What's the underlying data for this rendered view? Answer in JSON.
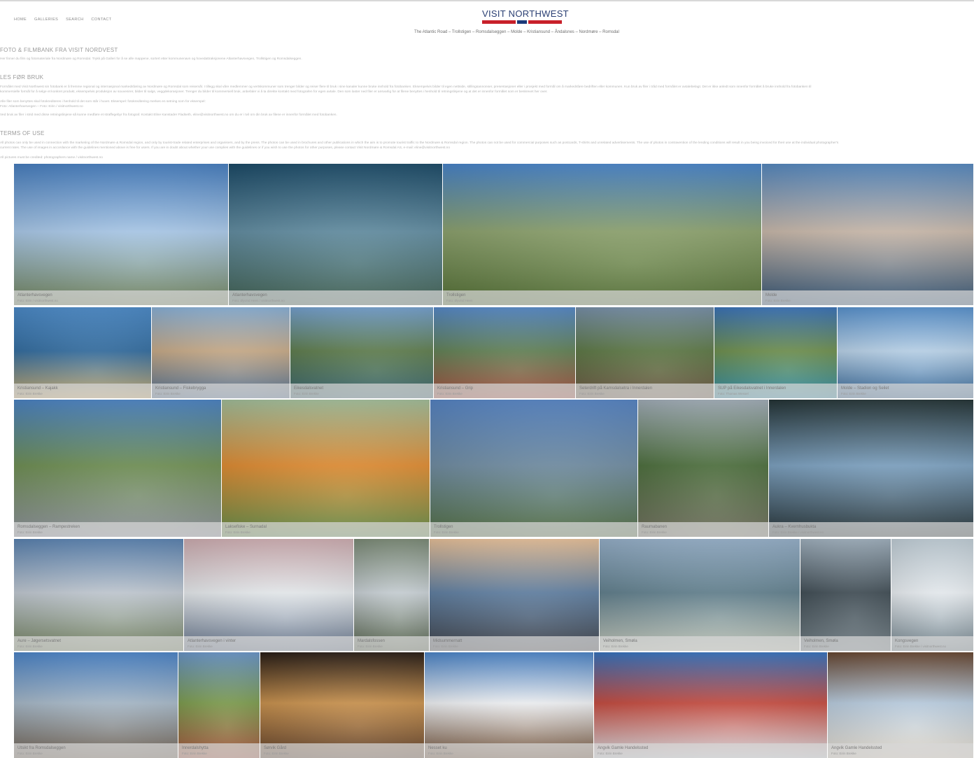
{
  "nav": [
    "HOME",
    "GALLERIES",
    "SEARCH",
    "CONTACT"
  ],
  "logo": "VISIT NORTHWEST",
  "tagline": "The Atlantic Road – Trollstigen – Romsdalseggen – Molde – Kristiansund – Åndalsnes – Nordmøre – Romsdal",
  "intro": {
    "heading": "FOTO & FILMBANK FRA VISIT NORDVEST",
    "text": "Her finner du film og fotomateriale fra Nordmøre og Romsdal. Trykk på Galleri for å se alle mappene, sortert etter kommunenavn og hovedattraksjonene Atlanterhavsvegen, Trollstigen og Romsdalseggen."
  },
  "rules": {
    "heading": "LES FØR BRUK",
    "lines": [
      "Formålet med Visit Northwest sin fotobank er å fremme regional og internasjonal markedsføring av Nordmøre og Romsdal som reisemål. I tillegg skal våre medlemmer og vertskommuner som trenger bilder og reiser flere til bruk i sine kanaler kunne bruke innhold fra fotobanken. Eksempelvis bilder til egen nettside, stillingsannonser, presentasjoner eller i prosjekt med formål om å markedsføre bedriften eller kommunen. Kun bruk av filer i tråd med formålet er avtalebelagt. Det er ikke anledt som innenfor formålet å bruke innhold fra fotobanken til",
      "kommersielle formål for å selge et konkret produkt, eksempelvis produksjon av souvenirer, bilder til salgs, veggdekorasjoner. Trenger du bilder til kommersiell bruk, anbefaler vi å ta direkte kontakt med fotografen for egen avtale. Den som laster ned filer er ansvarlig for at filene benyttes i henhold til retningslinjene og at det er innenfor formålet som er beskrevet her over.",
      "Alle filer som benyttes skal fotokrediteres i henhold til det som står i huvet. Eksempel: fotokreditering merkes en setning som for eksempel:",
      "Foto: Atlanterhavsvegen – Foto: Eirin / visitnorthwest.no",
      "Ved bruk av filer i strid med disse retningslinjene så kunne medføre et straffegebyr fra fotograf. Kontakt Eline Kanstader Fladseth, eline@visitnorthwest.no om du er i tvil om din bruk av filene er innenfor formålet med fotobanken."
    ]
  },
  "terms": {
    "heading": "TERMS OF USE",
    "lines": [
      "All photos can only be used in connection with the marketing of the Nordmøre & Romsdal region, and only by tourist-trade related enterprises and organisers, and by the press. The photos can be used in brochures and other publications in which the aim is to promote tourist traffic to the Nordmøre & Romsdal region. The photos can not be used for commercial purposes such as postcards, T-shirts and unrelated advertisements. The use of photos in contravention of the lending conditions will result in you being invoiced for their use at the individual photographer's",
      "current rates. The use of images in accordance with the guidelines mentioned above is free for users. If you are in doubt about whether your use complies with the guidelines or if you wish to use the photos for other purposes, please contact Visit Nordmøre & Romsdal AS, e-mail: eline@visitnorthwest.no",
      "All pictures must be credited: photographers name / visitnorthwest.no"
    ]
  },
  "galleries": [
    {
      "title": "Atlanterhavsvegen",
      "sub": "Foto: Eirin / visitnorthwest.no",
      "colors": [
        "#4a84c8",
        "#a9c9ea",
        "#6c7f56"
      ]
    },
    {
      "title": "Atlanterhavsvegen",
      "sub": "Foto: Øyvind Heen / visitnorthwest.no",
      "colors": [
        "#1d4e6c",
        "#5f8ba0",
        "#3b5c4c"
      ]
    },
    {
      "title": "Trollstigen",
      "sub": "Foto: Øyvind Heen",
      "colors": [
        "#4c8ad2",
        "#8aa06a",
        "#4e6b2f"
      ]
    },
    {
      "title": "Molde",
      "sub": "Foto: Eirin Brekke",
      "colors": [
        "#5a8fc8",
        "#c9b8a9",
        "#2d4f70"
      ]
    },
    {
      "title": "Kristiansund – Kajakk",
      "sub": "Foto: Eirin Brekke",
      "colors": [
        "#4f90d0",
        "#2f6a9e",
        "#c6a86a"
      ]
    },
    {
      "title": "Kristiansund – Fiskebrygga",
      "sub": "Foto: Eirin Brekke",
      "colors": [
        "#8fb8e0",
        "#c7a985",
        "#4b6b8f"
      ]
    },
    {
      "title": "Eikesdalsvatnet",
      "sub": "Foto: Eirin Brekke",
      "colors": [
        "#7aa8d8",
        "#5c7b4a",
        "#33616e"
      ]
    },
    {
      "title": "Kristiansund – Grip",
      "sub": "Foto: Eirin Brekke",
      "colors": [
        "#5a8fd0",
        "#5f7f52",
        "#a44a3a"
      ]
    },
    {
      "title": "Seterdrift på Kamsdalsetra i Innerdalen",
      "sub": "Foto: Eirin Brekke",
      "colors": [
        "#7d96b0",
        "#5a7642",
        "#6b5440"
      ]
    },
    {
      "title": "SUP på Eikesdalsvatnet i Innerdalen",
      "sub": "Foto: Thomas Wessel",
      "colors": [
        "#3d78c0",
        "#6b8d4a",
        "#2c8aa6"
      ]
    },
    {
      "title": "Molde – Stadion og Seilet",
      "sub": "Foto: Eirin Brekke",
      "colors": [
        "#5c98d6",
        "#b9d3ea",
        "#2b5f92"
      ]
    },
    {
      "title": "Romsdalseggen – Rampestreken",
      "sub": "Foto: Eirin Brekke",
      "colors": [
        "#4f89cc",
        "#6c8d50",
        "#8b8f9a"
      ]
    },
    {
      "title": "Laksefiske – Surnadal",
      "sub": "Foto: Eirin Brekke",
      "colors": [
        "#a9c6a1",
        "#e08a2e",
        "#5d8a45"
      ]
    },
    {
      "title": "Trollstigen",
      "sub": "Foto: Eirin Brekke",
      "colors": [
        "#5a8acc",
        "#6d8aa0",
        "#4d6a3c"
      ]
    },
    {
      "title": "Raumabanen",
      "sub": "Foto: Eirin Brekke",
      "colors": [
        "#a9b5c0",
        "#4a6d3a",
        "#6e6d5c"
      ]
    },
    {
      "title": "Aukra – Kvernhusbukta",
      "sub": "Foto: Eirin Brekke / visitnorthwest.no",
      "colors": [
        "#263638",
        "#7aa0c0",
        "#1e2b2e"
      ]
    },
    {
      "title": "Aure – Jøgersetsvatnet",
      "sub": "Foto: Eirin Brekke",
      "colors": [
        "#5e88b8",
        "#c1c9d2",
        "#6e7d5a"
      ]
    },
    {
      "title": "Atlanterhavsvegen i vinter",
      "sub": "Foto: Eirin Brekke",
      "colors": [
        "#d6b4b8",
        "#e8ecef",
        "#5e6e86"
      ]
    },
    {
      "title": "Mardalsfossen",
      "sub": "Foto: Eirin Brekke",
      "colors": [
        "#7f8f7a",
        "#c8d0d5",
        "#4e5c44"
      ]
    },
    {
      "title": "Midsummernatt",
      "sub": "Foto: Eirin Brekke",
      "colors": [
        "#f1c9a0",
        "#5d7da0",
        "#3a3d44"
      ]
    },
    {
      "title": "Veiholmen, Smøla",
      "sub": "Foto: Eirin Brekke",
      "colors": [
        "#9db8d2",
        "#5f7e8c",
        "#c2c7b9"
      ]
    },
    {
      "title": "Veiholmen, Smøla",
      "sub": "Foto: Eirin Brekke",
      "colors": [
        "#a7b8c6",
        "#3d4a52",
        "#6e7b82"
      ]
    },
    {
      "title": "Kongsvegen",
      "sub": "Foto: Eirin Brekke / visitnorthwest.no",
      "colors": [
        "#c8d6df",
        "#e9eef2",
        "#6d7f89"
      ]
    },
    {
      "title": "Utsikt fra Romsdalseggen",
      "sub": "Foto: Eirin Brekke",
      "colors": [
        "#4f8ad0",
        "#a6b8c8",
        "#6b5c4c"
      ]
    },
    {
      "title": "Innerdalshytta",
      "sub": "Foto: Eirin Brekke",
      "colors": [
        "#6e9bd0",
        "#7a9a4a",
        "#a4503a"
      ]
    },
    {
      "title": "Sørvik Gård",
      "sub": "Foto: Eirin Brekke",
      "colors": [
        "#2b1f18",
        "#c9904a",
        "#5a3a24"
      ]
    },
    {
      "title": "Nesset ku",
      "sub": "Foto: Eirin Brekke",
      "colors": [
        "#4f8ad0",
        "#f0f2f5",
        "#6b4a30"
      ]
    },
    {
      "title": "Angvik Gamle Handelssted",
      "sub": "Foto: Eirin Brekke",
      "colors": [
        "#3a78c6",
        "#c5483c",
        "#d7dbe0"
      ]
    },
    {
      "title": "Angvik Gamle Handelssted",
      "sub": "Foto: Eirin Brekke",
      "colors": [
        "#6b4a34",
        "#b9cde0",
        "#e6dccd"
      ]
    }
  ]
}
